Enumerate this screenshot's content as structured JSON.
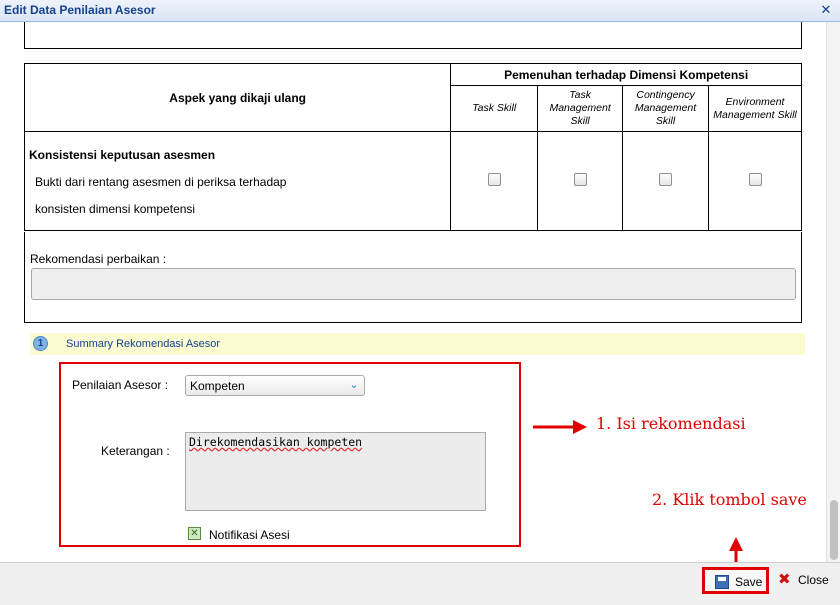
{
  "window": {
    "title": "Edit Data Penilaian Asesor",
    "close_icon": "close-icon"
  },
  "table": {
    "aspect_header": "Aspek yang dikaji ulang",
    "group_header": "Pemenuhan terhadap Dimensi Kompetensi",
    "columns": [
      {
        "line1": "Task Skill",
        "line2": "",
        "line3": ""
      },
      {
        "line1": "Task",
        "line2": "Management",
        "line3": "Skill"
      },
      {
        "line1": "Contingency",
        "line2": "Management",
        "line3": "Skill"
      },
      {
        "line1": "Environment",
        "line2": "Management Skill",
        "line3": ""
      }
    ],
    "row": {
      "title": "Konsistensi keputusan asesmen",
      "line1": "Bukti dari rentang asesmen di periksa terhadap",
      "line2": "konsisten dimensi kompetensi",
      "checked": [
        false,
        false,
        false,
        false
      ]
    }
  },
  "rekomendasi": {
    "label": "Rekomendasi perbaikan :",
    "value": ""
  },
  "summary": {
    "number": "1",
    "title": "Summary Rekomendasi Asesor"
  },
  "form": {
    "penilaian_label": "Penilaian Asesor :",
    "penilaian_value": "Kompeten",
    "keterangan_label": "Keterangan :",
    "keterangan_value": "Direkomendasikan kompeten",
    "notifikasi_label": "Notifikasi Asesi",
    "notifikasi_checked": true
  },
  "annotations": {
    "step1": "1. Isi rekomendasi",
    "step2": "2. Klik tombol save"
  },
  "footer": {
    "save_label": "Save",
    "close_label": "Close"
  },
  "colors": {
    "annotation": "#e10000",
    "title_text": "#15428b",
    "summary_bg": "#fbfbd2"
  }
}
